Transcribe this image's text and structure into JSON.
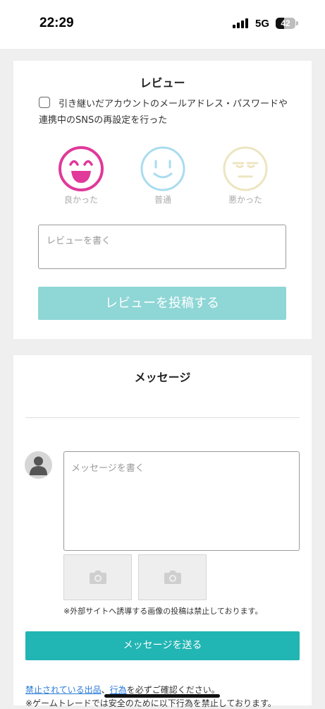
{
  "status": {
    "time": "22:29",
    "network": "5G",
    "battery": "42"
  },
  "review": {
    "title": "レビュー",
    "reset_checkbox_label": "引き継いだアカウントのメールアドレス・パスワードや連携中のSNSの再設定を行った",
    "ratings": [
      {
        "label": "良かった",
        "color": "#e0399a"
      },
      {
        "label": "普通",
        "color": "#a9dcef"
      },
      {
        "label": "悪かった",
        "color": "#ece5c0"
      }
    ],
    "input_placeholder": "レビューを書く",
    "submit_label": "レビューを投稿する"
  },
  "message": {
    "title": "メッセージ",
    "input_placeholder": "メッセージを書く",
    "image_notice": "※外部サイトへ誘導する画像の投稿は禁止しております。",
    "send_label": "メッセージを送る",
    "prohibited_items_link": "禁止されている出品",
    "separator": "、",
    "prohibited_acts_link": "行為",
    "confirm_text": "を必ずご確認ください。",
    "rules_text": "※ゲームトレードでは安全のために以下行為を禁止しております。"
  },
  "colors": {
    "accent": "#21b5b3",
    "accent_disabled": "#8fd6d6",
    "link": "#2a7bd8"
  }
}
